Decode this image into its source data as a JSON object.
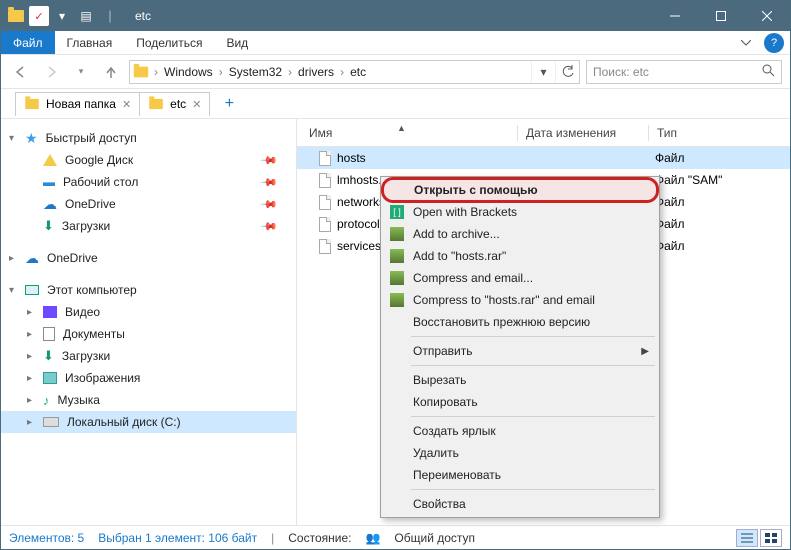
{
  "titlebar": {
    "title": "etc"
  },
  "menubar": {
    "file": "Файл",
    "items": [
      "Главная",
      "Поделиться",
      "Вид"
    ]
  },
  "breadcrumbs": [
    "Windows",
    "System32",
    "drivers",
    "etc"
  ],
  "search": {
    "placeholder": "Поиск: etc"
  },
  "folder_tabs": [
    {
      "label": "Новая папка",
      "icon": "folder"
    },
    {
      "label": "etc",
      "icon": "folder"
    }
  ],
  "navpane": {
    "quick_access": {
      "label": "Быстрый доступ",
      "items": [
        {
          "label": "Google Диск",
          "pinned": true,
          "icon": "gdrive"
        },
        {
          "label": "Рабочий стол",
          "pinned": true,
          "icon": "desktop"
        },
        {
          "label": "OneDrive",
          "pinned": true,
          "icon": "cloud"
        },
        {
          "label": "Загрузки",
          "pinned": true,
          "icon": "download"
        }
      ]
    },
    "onedrive": {
      "label": "OneDrive"
    },
    "this_pc": {
      "label": "Этот компьютер",
      "items": [
        {
          "label": "Видео",
          "icon": "video"
        },
        {
          "label": "Документы",
          "icon": "doc"
        },
        {
          "label": "Загрузки",
          "icon": "download"
        },
        {
          "label": "Изображения",
          "icon": "image"
        },
        {
          "label": "Музыка",
          "icon": "music"
        },
        {
          "label": "Локальный диск (C:)",
          "icon": "drive",
          "selected": true
        }
      ]
    }
  },
  "columns": {
    "name": "Имя",
    "date": "Дата изменения",
    "type": "Тип"
  },
  "files": [
    {
      "name": "hosts",
      "type": "Файл",
      "selected": true
    },
    {
      "name": "lmhosts.",
      "type": "Файл \"SAM\""
    },
    {
      "name": "networks",
      "type": "Файл"
    },
    {
      "name": "protocol",
      "type": "Файл"
    },
    {
      "name": "services",
      "type": "Файл"
    }
  ],
  "context_menu": [
    {
      "label": "Открыть с помощью",
      "highlight": true
    },
    {
      "label": "Open with Brackets",
      "icon": "brackets"
    },
    {
      "label": "Add to archive...",
      "icon": "rar"
    },
    {
      "label": "Add to \"hosts.rar\"",
      "icon": "rar"
    },
    {
      "label": "Compress and email...",
      "icon": "rar"
    },
    {
      "label": "Compress to \"hosts.rar\" and email",
      "icon": "rar"
    },
    {
      "label": "Восстановить прежнюю версию"
    },
    {
      "sep": true
    },
    {
      "label": "Отправить",
      "submenu": true
    },
    {
      "sep": true
    },
    {
      "label": "Вырезать"
    },
    {
      "label": "Копировать"
    },
    {
      "sep": true
    },
    {
      "label": "Создать ярлык"
    },
    {
      "label": "Удалить"
    },
    {
      "label": "Переименовать"
    },
    {
      "sep": true
    },
    {
      "label": "Свойства"
    }
  ],
  "status": {
    "count_label": "Элементов: 5",
    "selection_label": "Выбран 1 элемент: 106 байт",
    "state_label": "Состояние:",
    "sharing_label": "Общий доступ"
  }
}
